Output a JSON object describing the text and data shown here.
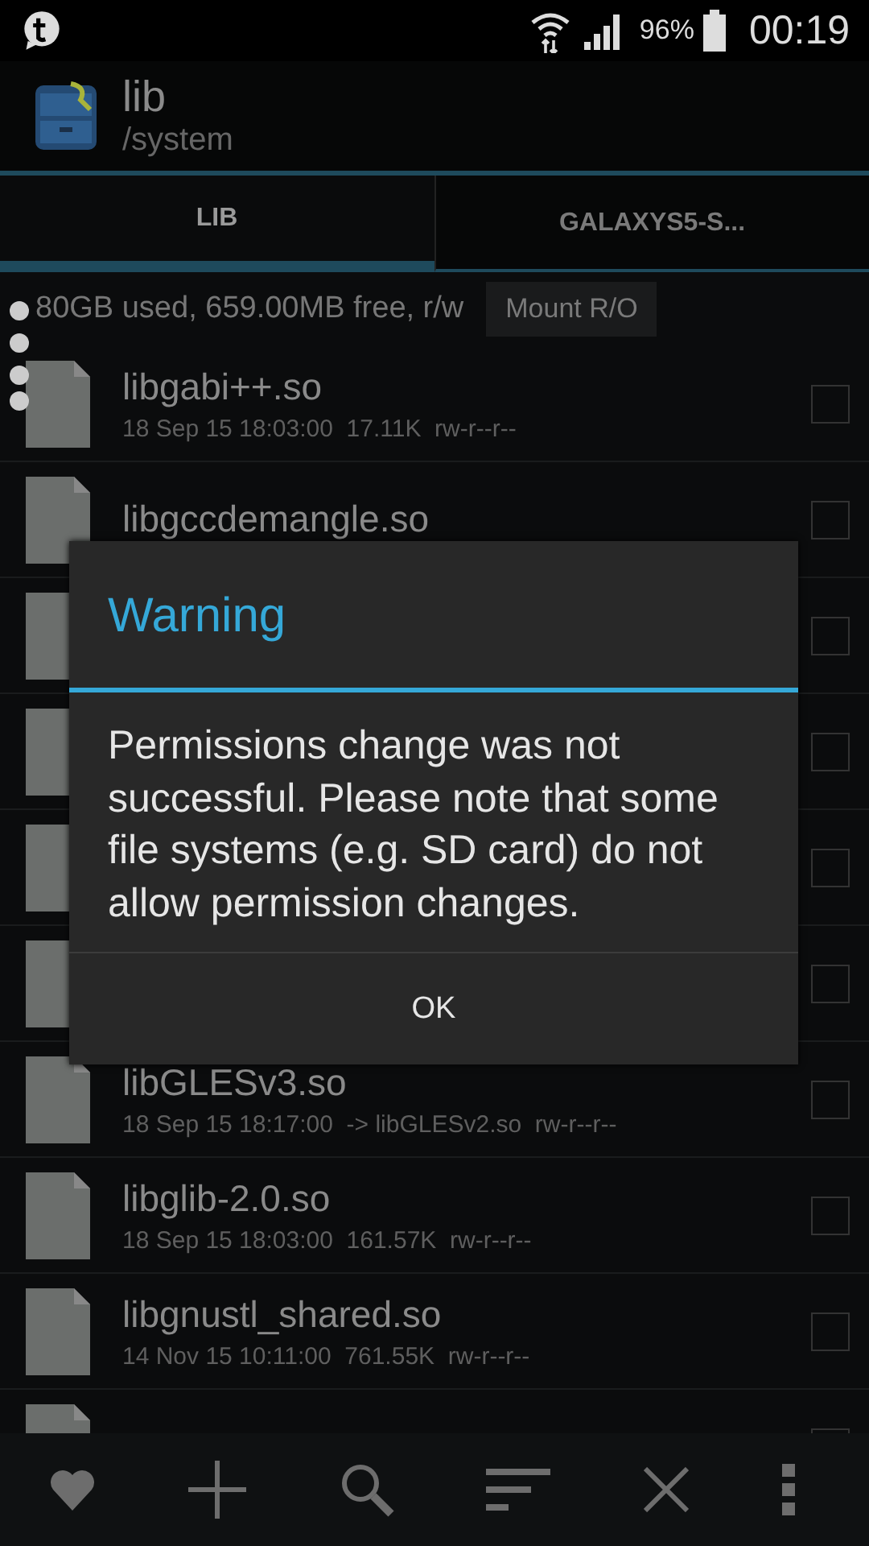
{
  "status_bar": {
    "battery": "96%",
    "time": "00:19"
  },
  "header": {
    "title": "lib",
    "subtitle": "/system"
  },
  "tabs": [
    {
      "label": "LIB",
      "selected": true
    },
    {
      "label": "GALAXYS5-S...",
      "selected": false
    }
  ],
  "info": {
    "text": "80GB used, 659.00MB free, r/w",
    "button": "Mount R/O"
  },
  "files": [
    {
      "name": "libgabi++.so",
      "date": "18 Sep 15 18:03:00",
      "size": "17.11K",
      "permissions": "rw-r--r--",
      "checked": false
    },
    {
      "name": "libgccdemangle.so",
      "checked": false
    },
    {
      "checked": false
    },
    {
      "checked": false
    },
    {
      "checked": false
    },
    {
      "checked": false
    },
    {
      "name": "libGLESv3.so",
      "date": "18 Sep 15 18:17:00",
      "size": "-> libGLESv2.so",
      "permissions": "rw-r--r--",
      "checked": false
    },
    {
      "name": "libglib-2.0.so",
      "date": "18 Sep 15 18:03:00",
      "size": "161.57K",
      "permissions": "rw-r--r--",
      "checked": false
    },
    {
      "name": "libgnustl_shared.so",
      "date": "14 Nov 15 10:11:00",
      "size": "761.55K",
      "permissions": "rw-r--r--",
      "checked": false
    },
    {
      "checked": false
    }
  ],
  "dialog": {
    "title": "Warning",
    "message": "Permissions change was not successful. Please note that some file systems (e.g. SD card) do not allow permission changes.",
    "button": "OK"
  }
}
